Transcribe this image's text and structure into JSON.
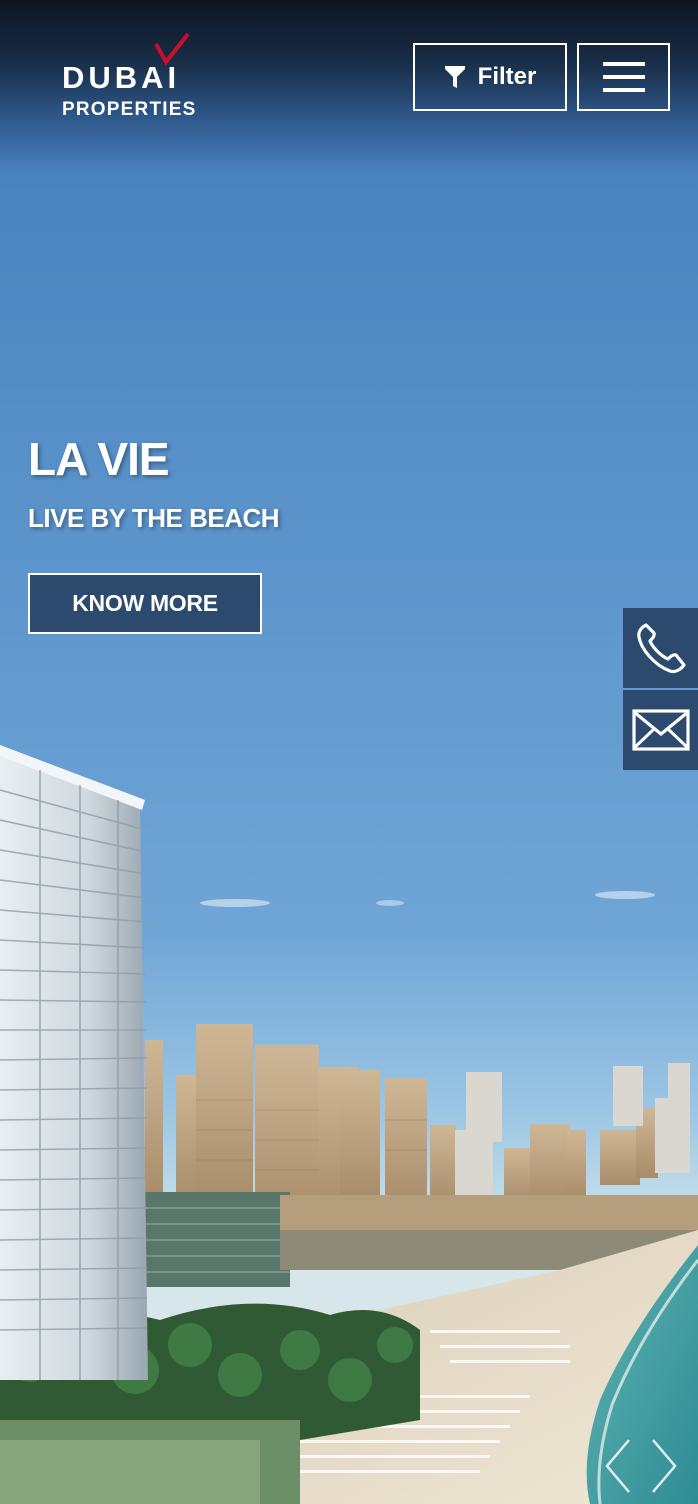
{
  "brand": {
    "logo_word": "DUBAI",
    "logo_sub": "PROPERTIES",
    "accent_color": "#c8102e"
  },
  "header": {
    "filter_label": "Filter",
    "filter_icon": "funnel-icon",
    "menu_icon": "hamburger-menu-icon"
  },
  "hero": {
    "title": "LA VIE",
    "subtitle": "LIVE BY THE BEACH",
    "cta_label": "KNOW MORE",
    "cta_color": "#2b4a6d"
  },
  "side_actions": {
    "call_icon": "phone-icon",
    "mail_icon": "envelope-icon"
  },
  "carousel": {
    "prev_icon": "chevron-left-icon",
    "next_icon": "chevron-right-icon"
  }
}
